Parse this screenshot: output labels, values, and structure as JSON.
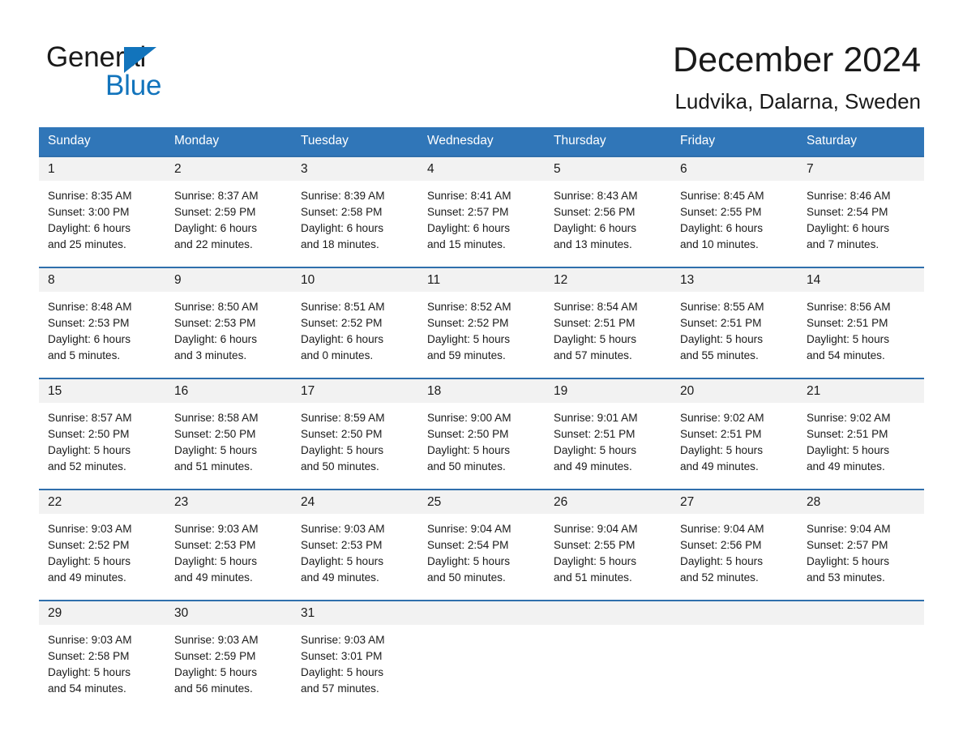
{
  "brand": {
    "name_part1": "General",
    "name_part2": "Blue",
    "logo_icon": "triangle-flag-icon",
    "accent_color": "#1274bc"
  },
  "header": {
    "month_title": "December 2024",
    "location": "Ludvika, Dalarna, Sweden"
  },
  "calendar": {
    "header_bg_color": "#3076b8",
    "daynum_band_color": "#f2f2f2",
    "row_divider_color": "#2f6fac",
    "weekday_headers": [
      "Sunday",
      "Monday",
      "Tuesday",
      "Wednesday",
      "Thursday",
      "Friday",
      "Saturday"
    ],
    "weeks": [
      [
        {
          "day": "1",
          "sunrise": "Sunrise: 8:35 AM",
          "sunset": "Sunset: 3:00 PM",
          "daylight_line1": "Daylight: 6 hours",
          "daylight_line2": "and 25 minutes."
        },
        {
          "day": "2",
          "sunrise": "Sunrise: 8:37 AM",
          "sunset": "Sunset: 2:59 PM",
          "daylight_line1": "Daylight: 6 hours",
          "daylight_line2": "and 22 minutes."
        },
        {
          "day": "3",
          "sunrise": "Sunrise: 8:39 AM",
          "sunset": "Sunset: 2:58 PM",
          "daylight_line1": "Daylight: 6 hours",
          "daylight_line2": "and 18 minutes."
        },
        {
          "day": "4",
          "sunrise": "Sunrise: 8:41 AM",
          "sunset": "Sunset: 2:57 PM",
          "daylight_line1": "Daylight: 6 hours",
          "daylight_line2": "and 15 minutes."
        },
        {
          "day": "5",
          "sunrise": "Sunrise: 8:43 AM",
          "sunset": "Sunset: 2:56 PM",
          "daylight_line1": "Daylight: 6 hours",
          "daylight_line2": "and 13 minutes."
        },
        {
          "day": "6",
          "sunrise": "Sunrise: 8:45 AM",
          "sunset": "Sunset: 2:55 PM",
          "daylight_line1": "Daylight: 6 hours",
          "daylight_line2": "and 10 minutes."
        },
        {
          "day": "7",
          "sunrise": "Sunrise: 8:46 AM",
          "sunset": "Sunset: 2:54 PM",
          "daylight_line1": "Daylight: 6 hours",
          "daylight_line2": "and 7 minutes."
        }
      ],
      [
        {
          "day": "8",
          "sunrise": "Sunrise: 8:48 AM",
          "sunset": "Sunset: 2:53 PM",
          "daylight_line1": "Daylight: 6 hours",
          "daylight_line2": "and 5 minutes."
        },
        {
          "day": "9",
          "sunrise": "Sunrise: 8:50 AM",
          "sunset": "Sunset: 2:53 PM",
          "daylight_line1": "Daylight: 6 hours",
          "daylight_line2": "and 3 minutes."
        },
        {
          "day": "10",
          "sunrise": "Sunrise: 8:51 AM",
          "sunset": "Sunset: 2:52 PM",
          "daylight_line1": "Daylight: 6 hours",
          "daylight_line2": "and 0 minutes."
        },
        {
          "day": "11",
          "sunrise": "Sunrise: 8:52 AM",
          "sunset": "Sunset: 2:52 PM",
          "daylight_line1": "Daylight: 5 hours",
          "daylight_line2": "and 59 minutes."
        },
        {
          "day": "12",
          "sunrise": "Sunrise: 8:54 AM",
          "sunset": "Sunset: 2:51 PM",
          "daylight_line1": "Daylight: 5 hours",
          "daylight_line2": "and 57 minutes."
        },
        {
          "day": "13",
          "sunrise": "Sunrise: 8:55 AM",
          "sunset": "Sunset: 2:51 PM",
          "daylight_line1": "Daylight: 5 hours",
          "daylight_line2": "and 55 minutes."
        },
        {
          "day": "14",
          "sunrise": "Sunrise: 8:56 AM",
          "sunset": "Sunset: 2:51 PM",
          "daylight_line1": "Daylight: 5 hours",
          "daylight_line2": "and 54 minutes."
        }
      ],
      [
        {
          "day": "15",
          "sunrise": "Sunrise: 8:57 AM",
          "sunset": "Sunset: 2:50 PM",
          "daylight_line1": "Daylight: 5 hours",
          "daylight_line2": "and 52 minutes."
        },
        {
          "day": "16",
          "sunrise": "Sunrise: 8:58 AM",
          "sunset": "Sunset: 2:50 PM",
          "daylight_line1": "Daylight: 5 hours",
          "daylight_line2": "and 51 minutes."
        },
        {
          "day": "17",
          "sunrise": "Sunrise: 8:59 AM",
          "sunset": "Sunset: 2:50 PM",
          "daylight_line1": "Daylight: 5 hours",
          "daylight_line2": "and 50 minutes."
        },
        {
          "day": "18",
          "sunrise": "Sunrise: 9:00 AM",
          "sunset": "Sunset: 2:50 PM",
          "daylight_line1": "Daylight: 5 hours",
          "daylight_line2": "and 50 minutes."
        },
        {
          "day": "19",
          "sunrise": "Sunrise: 9:01 AM",
          "sunset": "Sunset: 2:51 PM",
          "daylight_line1": "Daylight: 5 hours",
          "daylight_line2": "and 49 minutes."
        },
        {
          "day": "20",
          "sunrise": "Sunrise: 9:02 AM",
          "sunset": "Sunset: 2:51 PM",
          "daylight_line1": "Daylight: 5 hours",
          "daylight_line2": "and 49 minutes."
        },
        {
          "day": "21",
          "sunrise": "Sunrise: 9:02 AM",
          "sunset": "Sunset: 2:51 PM",
          "daylight_line1": "Daylight: 5 hours",
          "daylight_line2": "and 49 minutes."
        }
      ],
      [
        {
          "day": "22",
          "sunrise": "Sunrise: 9:03 AM",
          "sunset": "Sunset: 2:52 PM",
          "daylight_line1": "Daylight: 5 hours",
          "daylight_line2": "and 49 minutes."
        },
        {
          "day": "23",
          "sunrise": "Sunrise: 9:03 AM",
          "sunset": "Sunset: 2:53 PM",
          "daylight_line1": "Daylight: 5 hours",
          "daylight_line2": "and 49 minutes."
        },
        {
          "day": "24",
          "sunrise": "Sunrise: 9:03 AM",
          "sunset": "Sunset: 2:53 PM",
          "daylight_line1": "Daylight: 5 hours",
          "daylight_line2": "and 49 minutes."
        },
        {
          "day": "25",
          "sunrise": "Sunrise: 9:04 AM",
          "sunset": "Sunset: 2:54 PM",
          "daylight_line1": "Daylight: 5 hours",
          "daylight_line2": "and 50 minutes."
        },
        {
          "day": "26",
          "sunrise": "Sunrise: 9:04 AM",
          "sunset": "Sunset: 2:55 PM",
          "daylight_line1": "Daylight: 5 hours",
          "daylight_line2": "and 51 minutes."
        },
        {
          "day": "27",
          "sunrise": "Sunrise: 9:04 AM",
          "sunset": "Sunset: 2:56 PM",
          "daylight_line1": "Daylight: 5 hours",
          "daylight_line2": "and 52 minutes."
        },
        {
          "day": "28",
          "sunrise": "Sunrise: 9:04 AM",
          "sunset": "Sunset: 2:57 PM",
          "daylight_line1": "Daylight: 5 hours",
          "daylight_line2": "and 53 minutes."
        }
      ],
      [
        {
          "day": "29",
          "sunrise": "Sunrise: 9:03 AM",
          "sunset": "Sunset: 2:58 PM",
          "daylight_line1": "Daylight: 5 hours",
          "daylight_line2": "and 54 minutes."
        },
        {
          "day": "30",
          "sunrise": "Sunrise: 9:03 AM",
          "sunset": "Sunset: 2:59 PM",
          "daylight_line1": "Daylight: 5 hours",
          "daylight_line2": "and 56 minutes."
        },
        {
          "day": "31",
          "sunrise": "Sunrise: 9:03 AM",
          "sunset": "Sunset: 3:01 PM",
          "daylight_line1": "Daylight: 5 hours",
          "daylight_line2": "and 57 minutes."
        },
        {
          "day": "",
          "sunrise": "",
          "sunset": "",
          "daylight_line1": "",
          "daylight_line2": ""
        },
        {
          "day": "",
          "sunrise": "",
          "sunset": "",
          "daylight_line1": "",
          "daylight_line2": ""
        },
        {
          "day": "",
          "sunrise": "",
          "sunset": "",
          "daylight_line1": "",
          "daylight_line2": ""
        },
        {
          "day": "",
          "sunrise": "",
          "sunset": "",
          "daylight_line1": "",
          "daylight_line2": ""
        }
      ]
    ]
  }
}
